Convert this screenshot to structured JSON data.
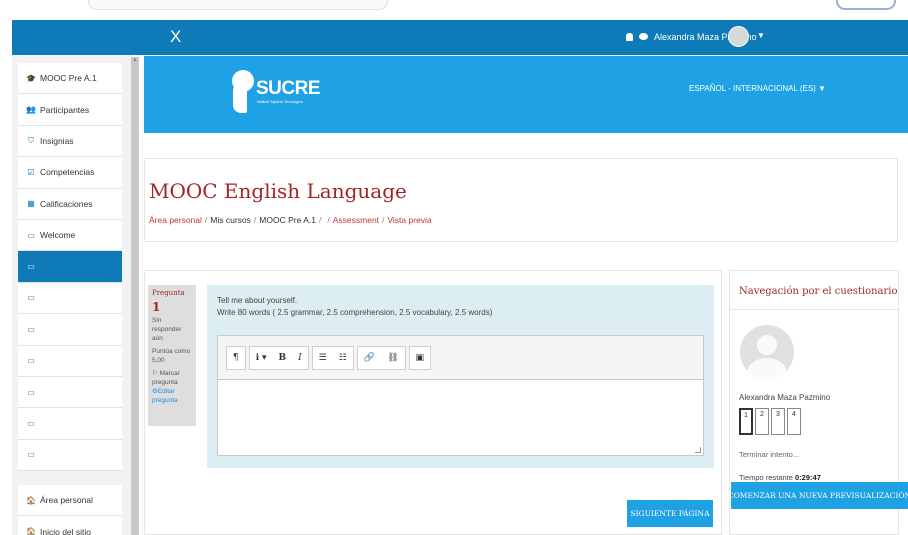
{
  "navbar": {
    "close_glyph": "X",
    "user_name": "Alexandra Maza Pazmino",
    "caret": "▼"
  },
  "sidebar": {
    "items": [
      {
        "icon": "graduation-cap-icon",
        "glyph": "🎓",
        "label": "MOOC Pre A.1"
      },
      {
        "icon": "users-icon",
        "glyph": "👥",
        "label": "Participantes"
      },
      {
        "icon": "shield-icon",
        "glyph": "⛉",
        "label": "Insignias"
      },
      {
        "icon": "check-square-icon",
        "glyph": "☑",
        "label": "Competencias"
      },
      {
        "icon": "table-icon",
        "glyph": "▦",
        "label": "Calificaciones"
      },
      {
        "icon": "folder-icon",
        "glyph": "▭",
        "label": "Welcome"
      },
      {
        "icon": "folder-icon",
        "glyph": "▭",
        "label": ""
      },
      {
        "icon": "folder-icon",
        "glyph": "▭",
        "label": ""
      },
      {
        "icon": "folder-icon",
        "glyph": "▭",
        "label": ""
      },
      {
        "icon": "folder-icon",
        "glyph": "▭",
        "label": ""
      },
      {
        "icon": "folder-icon",
        "glyph": "▭",
        "label": ""
      },
      {
        "icon": "folder-icon",
        "glyph": "▭",
        "label": ""
      },
      {
        "icon": "folder-icon",
        "glyph": "▭",
        "label": ""
      }
    ],
    "active_index": 6,
    "bottom_items": [
      {
        "icon": "dashboard-icon",
        "glyph": "🏠",
        "label": "Área personal"
      },
      {
        "icon": "home-icon",
        "glyph": "🏠",
        "label": "Inicio del sitio"
      }
    ]
  },
  "banner": {
    "logo_text": "SUCRE",
    "logo_subtext": "Instituto Superior Tecnológico",
    "language": "ESPAÑOL - INTERNACIONAL (ES) ▼"
  },
  "header": {
    "title": "MOOC English Language",
    "breadcrumb": {
      "b1": "Área personal",
      "b2": "Mis cursos",
      "b3": "MOOC Pre A.1",
      "b4": "Assessment",
      "b5": "Vista previa"
    }
  },
  "question": {
    "label": "Pregunta",
    "number": "1",
    "status": "Sin responder aún",
    "score": "Puntúa como 5,00",
    "flag": "Marcar pregunta",
    "edit": "Editar pregunta",
    "text_line1": "Tell me about yourself.",
    "text_line2": "Write 80 words ( 2.5 grammar, 2.5 comprehension, 2.5 vocabulary, 2.5 words)"
  },
  "editor": {
    "tb_paragraph": "¶",
    "tb_info": "ℹ ▾",
    "tb_bold": "B",
    "tb_italic": "I",
    "tb_ul": "☰",
    "tb_ol": "☷",
    "tb_link": "🔗",
    "tb_unlink": "⛓",
    "tb_image": "▣"
  },
  "buttons": {
    "next_page": "SIGUIENTE PÁGINA",
    "new_preview": "COMENZAR UNA NUEVA PREVISUALIZACIÓN"
  },
  "quiznav": {
    "title": "Navegación por el cuestionario",
    "user_name": "Alexandra Maza Pazmino",
    "questions": [
      "1",
      "2",
      "3",
      "4"
    ],
    "current_index": 0,
    "finish_attempt": "Terminar intento...",
    "time_label": "Tiempo restante",
    "time_value": "0:29:47"
  },
  "colors": {
    "primary": "#0f7ab8",
    "banner": "#1fa1e6",
    "title": "#a32626",
    "question_bg": "#dcedf4"
  }
}
